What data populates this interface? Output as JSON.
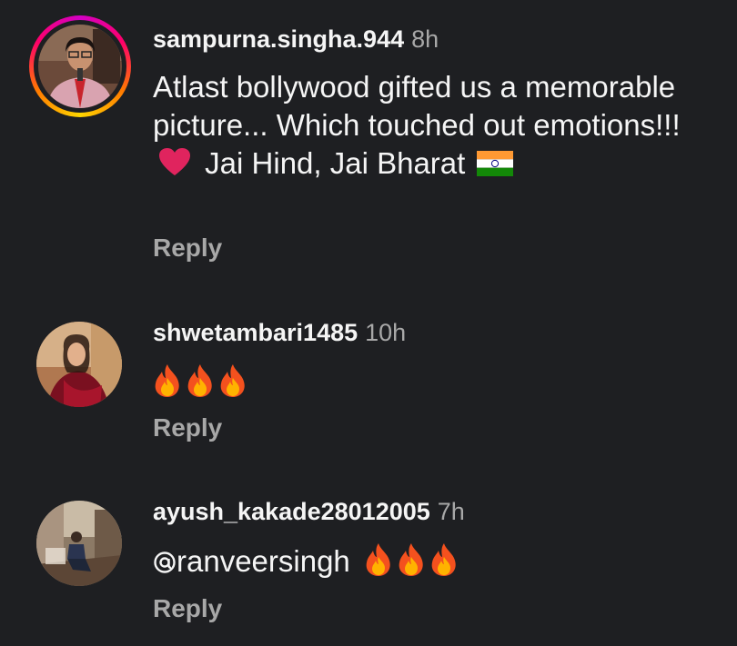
{
  "comments": [
    {
      "username": "sampurna.singha.944",
      "time": "8h",
      "text_before_heart": "Atlast bollywood gifted us a memorable picture... Which touched out emotions!!!",
      "text_after_heart": "Jai Hind, Jai Bharat",
      "emojis": [
        "heart",
        "india-flag"
      ],
      "reply_label": "Reply",
      "has_story_ring": true
    },
    {
      "username": "shwetambari1485",
      "time": "10h",
      "emojis": [
        "fire",
        "fire",
        "fire"
      ],
      "reply_label": "Reply",
      "has_story_ring": false
    },
    {
      "username": "ayush_kakade28012005",
      "time": "7h",
      "mention": "ranveersingh",
      "emojis": [
        "fire",
        "fire",
        "fire"
      ],
      "reply_label": "Reply",
      "has_story_ring": false
    }
  ],
  "colors": {
    "background": "#1e1f22",
    "text": "#f5f5f5",
    "muted": "#a8a8a8",
    "heart": "#e0245e"
  }
}
